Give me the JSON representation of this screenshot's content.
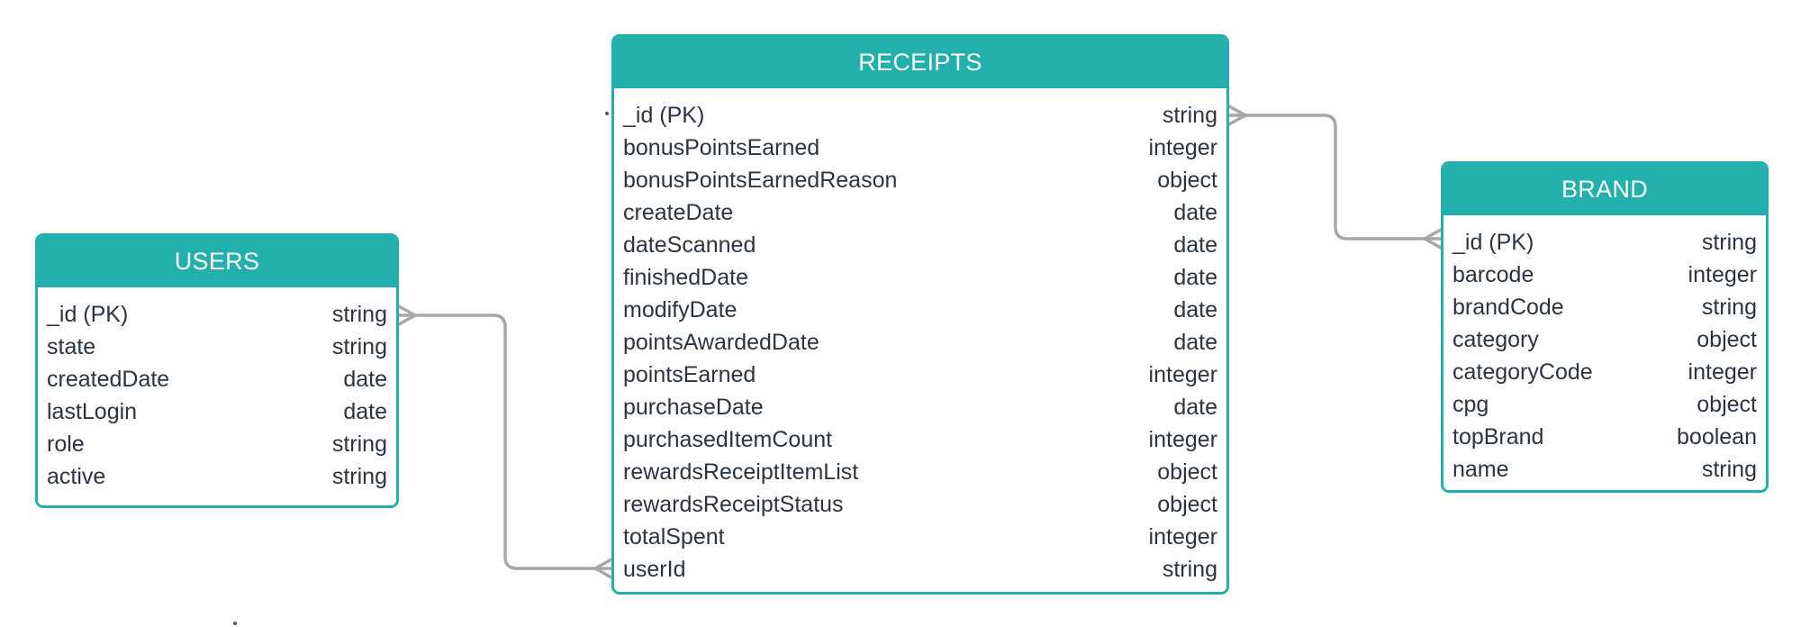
{
  "colors": {
    "accent": "#23b0ad",
    "connector": "#a7a7a7",
    "text": "#2c3440"
  },
  "entities": {
    "users": {
      "title": "USERS",
      "fields": [
        {
          "name": "_id (PK)",
          "type": "string"
        },
        {
          "name": "state",
          "type": "string"
        },
        {
          "name": "createdDate",
          "type": "date"
        },
        {
          "name": "lastLogin",
          "type": "date"
        },
        {
          "name": "role",
          "type": "string"
        },
        {
          "name": "active",
          "type": "string"
        }
      ]
    },
    "receipts": {
      "title": "RECEIPTS",
      "fields": [
        {
          "name": "_id (PK)",
          "type": "string"
        },
        {
          "name": "bonusPointsEarned",
          "type": "integer"
        },
        {
          "name": "bonusPointsEarnedReason",
          "type": "object"
        },
        {
          "name": "createDate",
          "type": "date"
        },
        {
          "name": "dateScanned",
          "type": "date"
        },
        {
          "name": "finishedDate",
          "type": "date"
        },
        {
          "name": "modifyDate",
          "type": "date"
        },
        {
          "name": "pointsAwardedDate",
          "type": "date"
        },
        {
          "name": "pointsEarned",
          "type": "integer"
        },
        {
          "name": "purchaseDate",
          "type": "date"
        },
        {
          "name": "purchasedItemCount",
          "type": "integer"
        },
        {
          "name": "rewardsReceiptItemList",
          "type": "object"
        },
        {
          "name": "rewardsReceiptStatus",
          "type": "object"
        },
        {
          "name": "totalSpent",
          "type": "integer"
        },
        {
          "name": "userId",
          "type": "string"
        }
      ]
    },
    "brand": {
      "title": "BRAND",
      "fields": [
        {
          "name": "_id (PK)",
          "type": "string"
        },
        {
          "name": "barcode",
          "type": "integer"
        },
        {
          "name": "brandCode",
          "type": "string"
        },
        {
          "name": "category",
          "type": "object"
        },
        {
          "name": "categoryCode",
          "type": "integer"
        },
        {
          "name": "cpg",
          "type": "object"
        },
        {
          "name": "topBrand",
          "type": "boolean"
        },
        {
          "name": "name",
          "type": "string"
        }
      ]
    }
  },
  "relationships": [
    {
      "from": "users._id (PK)",
      "to": "receipts.userId",
      "end_style": "crow-foot"
    },
    {
      "from": "receipts._id (PK)",
      "to": "brand._id (PK)",
      "end_style": "crow-foot"
    }
  ]
}
